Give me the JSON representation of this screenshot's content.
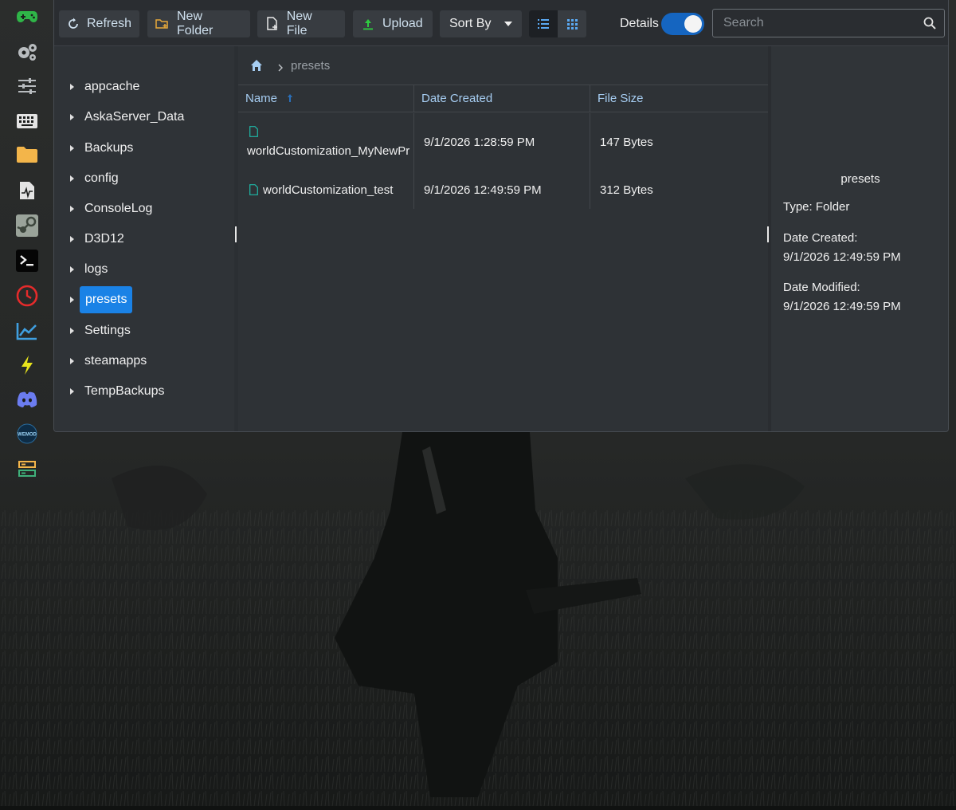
{
  "colors": {
    "accent": "#1a82e6",
    "toggle_on": "#1565c0",
    "header_text": "#a6cdf2",
    "file_icon": "#1fb8a8",
    "upload_icon": "#2ecc40"
  },
  "sidebar": {
    "items": [
      {
        "icon": "gamepad-icon"
      },
      {
        "icon": "gears-icon"
      },
      {
        "icon": "sliders-icon"
      },
      {
        "icon": "keyboard-icon"
      },
      {
        "icon": "folder-icon"
      },
      {
        "icon": "activity-file-icon"
      },
      {
        "icon": "steam-icon"
      },
      {
        "icon": "terminal-icon"
      },
      {
        "icon": "clock-icon"
      },
      {
        "icon": "chart-icon"
      },
      {
        "icon": "lightning-icon"
      },
      {
        "icon": "discord-icon"
      },
      {
        "icon": "wemod-icon",
        "text": "WEMOD"
      },
      {
        "icon": "server-list-icon"
      }
    ]
  },
  "toolbar": {
    "refresh_label": "Refresh",
    "new_folder_label": "New Folder",
    "new_file_label": "New File",
    "upload_label": "Upload",
    "sort_by_label": "Sort By",
    "details_label": "Details",
    "details_enabled": true,
    "search_placeholder": "Search"
  },
  "tree": {
    "items": [
      {
        "label": "appcache"
      },
      {
        "label": "AskaServer_Data"
      },
      {
        "label": "Backups"
      },
      {
        "label": "config"
      },
      {
        "label": "ConsoleLog"
      },
      {
        "label": "D3D12"
      },
      {
        "label": "logs"
      },
      {
        "label": "presets",
        "selected": true
      },
      {
        "label": "Settings"
      },
      {
        "label": "steamapps"
      },
      {
        "label": "TempBackups"
      }
    ]
  },
  "breadcrumb": {
    "current": "presets"
  },
  "table": {
    "columns": [
      "Name",
      "Date Created",
      "File Size"
    ],
    "sort": {
      "column": "Name",
      "direction": "asc"
    },
    "rows": [
      {
        "name": "worldCustomization_MyNewPr",
        "date": "9/1/2026 1:28:59 PM",
        "size": "147 Bytes"
      },
      {
        "name": "worldCustomization_test",
        "date": "9/1/2026 12:49:59 PM",
        "size": "312 Bytes"
      }
    ]
  },
  "details": {
    "title": "presets",
    "type_line": "Type: Folder",
    "date_created_label": "Date Created:",
    "date_created_value": "9/1/2026 12:49:59 PM",
    "date_modified_label": "Date Modified:",
    "date_modified_value": "9/1/2026 12:49:59 PM"
  }
}
